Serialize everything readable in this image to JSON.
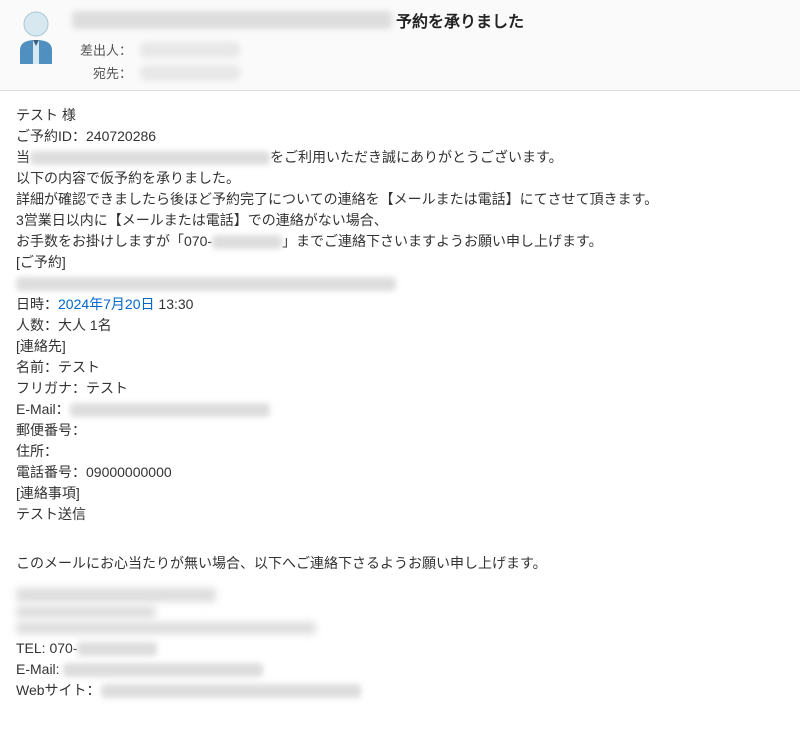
{
  "header": {
    "subject_suffix": "予約を承りました",
    "from_label": "差出人：",
    "to_label": "宛先："
  },
  "body": {
    "greeting_line1": "テスト 様",
    "greeting_line2": "ご予約ID：240720286",
    "thanks_prefix": "当",
    "thanks_suffix": "をご利用いただき誠にありがとうございます。",
    "accept_line1": "以下の内容で仮予約を承りました。",
    "accept_line2": "詳細が確認できましたら後ほど予約完了についての連絡を【メールまたは電話】にてさせて頂きます。",
    "notice_line1": "3営業日以内に【メールまたは電話】での連絡がない場合、",
    "notice_line2a": "お手数をお掛けしますが「070-",
    "notice_line2b": "」までご連絡下さいますようお願い申し上げます。",
    "reservation_header": "[ご予約]",
    "reservation_datetime_label": "日時：",
    "reservation_date": "2024年7月20日",
    "reservation_time": " 13:30",
    "reservation_count": "人数：大人 1名",
    "contact_header": "[連絡先]",
    "contact_name": "名前：テスト",
    "contact_kana": "フリガナ：テスト",
    "contact_email_label": "E-Mail：",
    "contact_postal": "郵便番号：",
    "contact_address": "住所：",
    "contact_phone": "電話番号：09000000000",
    "notes_header": "[連絡事項]",
    "notes_body": "テスト送信",
    "disclaimer": "このメールにお心当たりが無い場合、以下へご連絡下さるようお願い申し上げます。",
    "footer_tel": "TEL: 070-",
    "footer_email": "E-Mail:",
    "footer_web": "Webサイト："
  }
}
